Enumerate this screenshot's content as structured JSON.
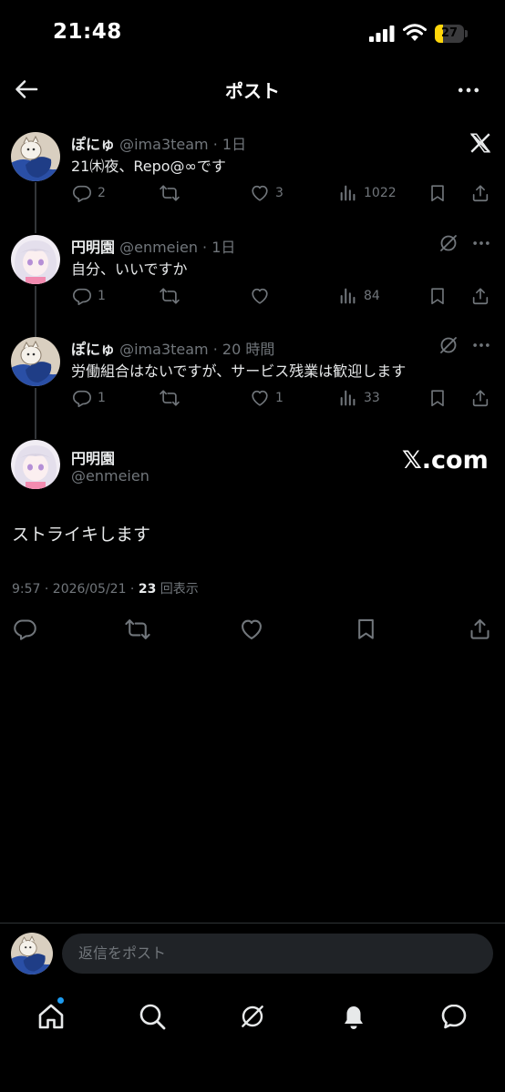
{
  "status_bar": {
    "time": "21:48",
    "battery_level": "27",
    "battery_fraction": 0.27
  },
  "header": {
    "title": "ポスト"
  },
  "replies": [
    {
      "name": "ぽにゅ",
      "meta": "@ima3team · 1日",
      "text": "21㈭夜、Repo@∞です",
      "reply_count": "2",
      "repost_count": "",
      "like_count": "3",
      "view_count": "1022"
    },
    {
      "name": "円明園",
      "meta": "@enmeien · 1日",
      "text": "自分、いいですか",
      "reply_count": "1",
      "repost_count": "",
      "like_count": "",
      "view_count": "84"
    },
    {
      "name": "ぽにゅ",
      "meta": "@ima3team · 20 時間",
      "text": "労働組合はないですが、サービス残業は歓迎します",
      "reply_count": "1",
      "repost_count": "",
      "like_count": "1",
      "view_count": "33"
    }
  ],
  "main_post": {
    "name": "円明園",
    "handle": "@enmeien",
    "watermark": "𝕏.com",
    "text": "ストライキします",
    "timestamp_prefix": "9:57 · 2026/05/21 · ",
    "view_count": "23",
    "view_label": " 回表示"
  },
  "reply_bar": {
    "placeholder": "返信をポスト"
  },
  "icons": {
    "back": "arrow-left-icon",
    "more": "more-horizontal-icon",
    "x_logo": "x-logo-icon",
    "grok": "grok-icon",
    "reply": "reply-icon",
    "repost": "repost-icon",
    "like": "heart-icon",
    "views": "views-icon",
    "bookmark": "bookmark-icon",
    "share": "share-icon",
    "home": "home-icon",
    "search": "search-icon",
    "notifications": "bell-icon",
    "messages": "messages-icon"
  },
  "colors": {
    "background": "#000000",
    "accent": "#1d9bf0",
    "muted": "#71767b",
    "text": "#e7e9ea",
    "battery": "#ffd60a"
  }
}
